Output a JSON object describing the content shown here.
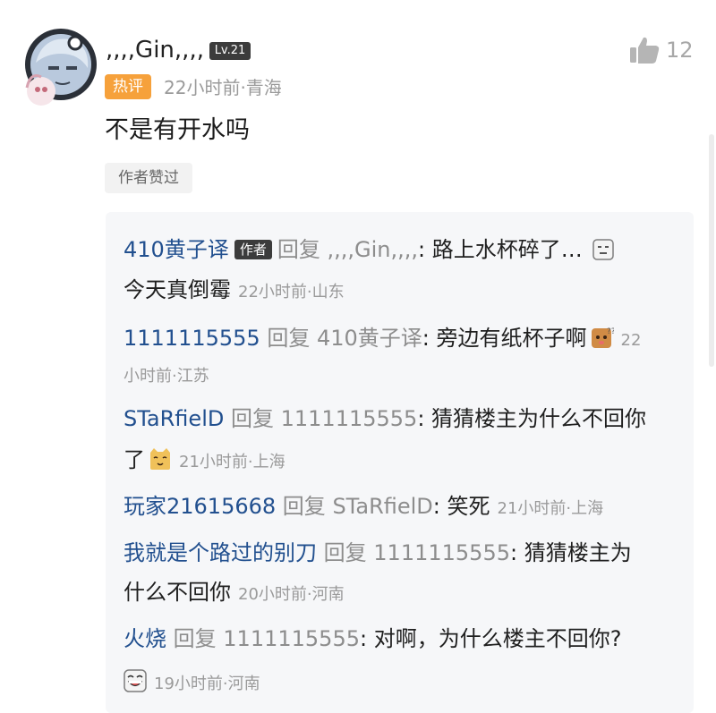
{
  "comment": {
    "username": ",,,,Gin,,,,",
    "level": "Lv.21",
    "hot_tag": "热评",
    "meta": "22小时前·青海",
    "likes": "12",
    "content": "不是有开水吗",
    "author_liked": "作者赞过"
  },
  "reply_word": "回复",
  "author_tag": "作者",
  "replies": [
    {
      "user": "410黄子译",
      "target": ",,,,Gin,,,,",
      "text1": ": 路上水杯碎了…",
      "text2": "今天真倒霉",
      "time": "22小时前·山东"
    },
    {
      "user": "1111115555",
      "target": "410黄子译",
      "text1": ": 旁边有纸杯子啊",
      "time_part1": "22",
      "time_part2": "小时前·江苏"
    },
    {
      "user": "STaRfielD",
      "target": "1111115555",
      "text1": ": 猜猜楼主为什么不回你",
      "text2": "了",
      "time": "21小时前·上海"
    },
    {
      "user": "玩家21615668",
      "target": "STaRfielD",
      "text1": ": 笑死",
      "time": "21小时前·上海"
    },
    {
      "user": "我就是个路过的别刀",
      "target": "1111115555",
      "text1": ": 猜猜楼主为",
      "text2": "什么不回你",
      "time": "20小时前·河南"
    },
    {
      "user": "火烧",
      "target": "1111115555",
      "text1": ": 对啊，为什么楼主不回你?",
      "time": "19小时前·河南"
    }
  ],
  "icons": {
    "like": "thumbs-up-icon",
    "emoji_plain": "plain-face-emoji",
    "emoji_shy": "shy-face-emoji",
    "emoji_cat": "cat-face-emoji",
    "emoji_smile": "big-smile-emoji"
  }
}
